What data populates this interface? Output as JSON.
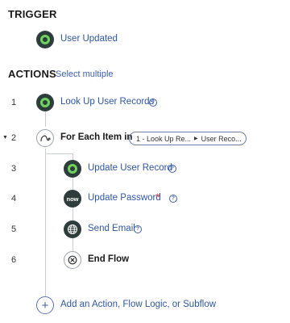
{
  "trigger": {
    "heading": "TRIGGER",
    "name": "User Updated",
    "icon": "servicenow-green-icon"
  },
  "actions": {
    "heading": "ACTIONS",
    "select_multiple": "Select multiple",
    "steps": [
      {
        "num": "1",
        "label": "Look Up User Records",
        "icon": "servicenow-green-icon"
      },
      {
        "num": "2",
        "label": "For Each Item in",
        "icon": "loop-icon",
        "pill_first": "1 - Look Up Re...",
        "pill_second": "User Reco..."
      },
      {
        "num": "3",
        "label": "Update User Record",
        "icon": "servicenow-green-icon"
      },
      {
        "num": "4",
        "label": "Update Password",
        "icon": "now-logo-icon",
        "required_mark": "*",
        "now_text": "now"
      },
      {
        "num": "5",
        "label": "Send Email",
        "icon": "globe-icon"
      },
      {
        "num": "6",
        "label": "End Flow",
        "icon": "end-flow-icon"
      }
    ],
    "add_label": "Add an Action, Flow Logic, or Subflow"
  },
  "colors": {
    "link": "#3d5fae",
    "green_ring": "#6fd45c",
    "icon_dark": "#2e3d3b",
    "required": "#d9363e",
    "connector": "#c9ced6"
  }
}
